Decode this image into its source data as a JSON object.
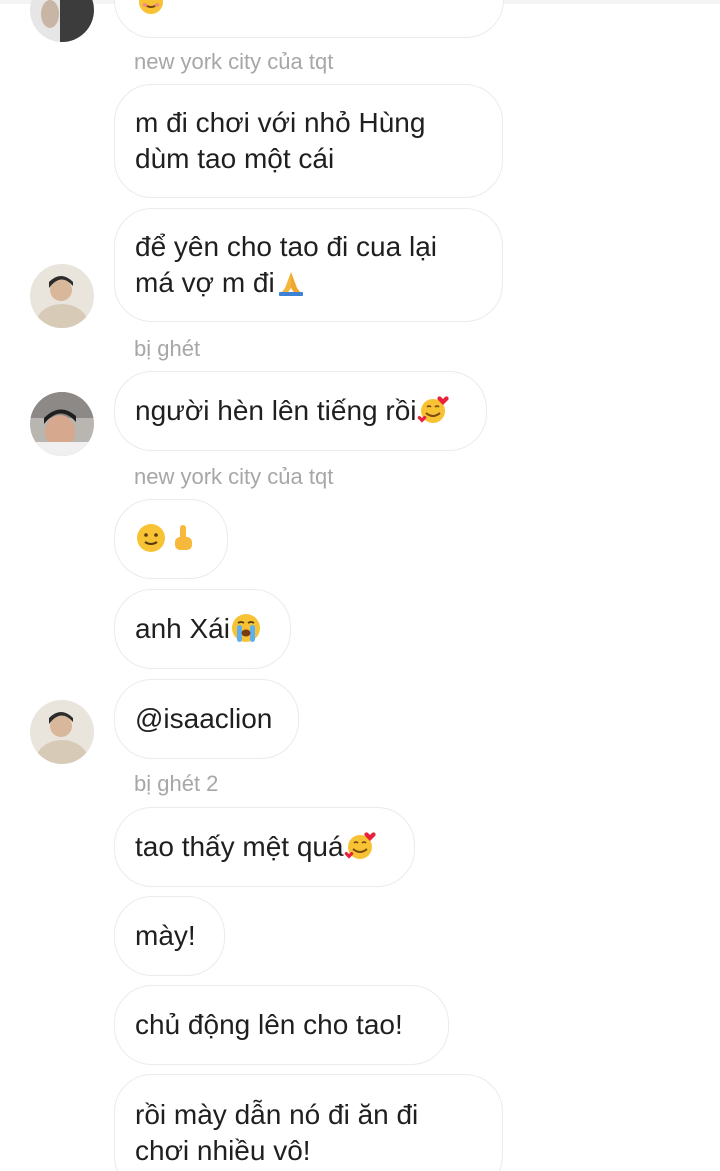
{
  "messages": [
    {
      "type": "bubble",
      "text": "",
      "emoji": "smiling-hearts-icon"
    },
    {
      "type": "sender",
      "text": "new york city của tqt"
    },
    {
      "type": "bubble",
      "text": "m đi chơi với nhỏ Hùng\ndùm tao một cái"
    },
    {
      "type": "bubble",
      "text": "để yên cho tao đi cua lại\nmá vợ m đi",
      "emoji": "folded-hands-icon"
    },
    {
      "type": "sender",
      "text": "bị ghét"
    },
    {
      "type": "bubble",
      "text": "người hèn lên tiếng rồi",
      "emoji": "smiling-hearts-icon"
    },
    {
      "type": "sender",
      "text": "new york city của tqt"
    },
    {
      "type": "bubble",
      "text": "",
      "emoji": "slight-smile-icon",
      "emoji2": "middle-finger-icon"
    },
    {
      "type": "bubble",
      "text": "anh Xái",
      "emoji": "loudly-crying-icon"
    },
    {
      "type": "bubble",
      "text": "@isaaclion"
    },
    {
      "type": "sender",
      "text": "bị ghét 2"
    },
    {
      "type": "bubble",
      "text": "tao thấy mệt quá",
      "emoji": "smiling-hearts-icon"
    },
    {
      "type": "bubble",
      "text": "mày!"
    },
    {
      "type": "bubble",
      "text": "chủ động lên cho tao!"
    },
    {
      "type": "bubble",
      "text": "rồi mày dẫn nó đi ăn đi\nchơi nhiều vô!"
    }
  ],
  "colors": {
    "bubble_border": "#ebebeb",
    "sender_name": "#a7a7a7",
    "message_text": "#1f1f1f",
    "background": "#ffffff"
  }
}
